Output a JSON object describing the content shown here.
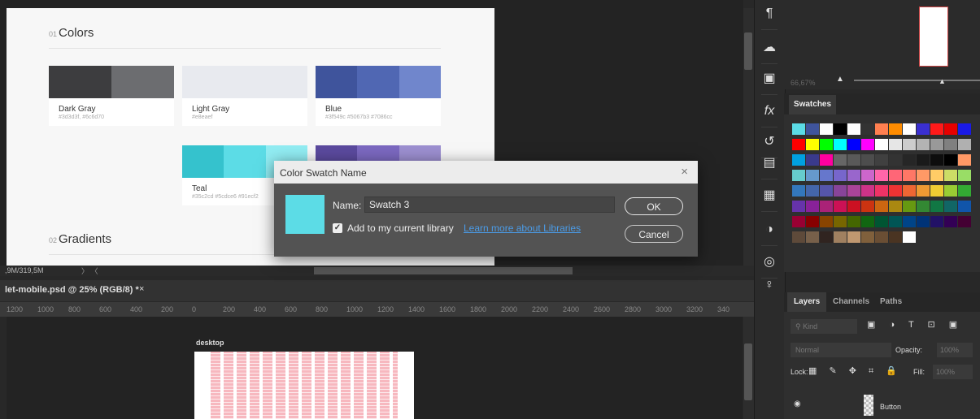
{
  "document_preview": {
    "colors_section": {
      "num": "01",
      "title": "Colors"
    },
    "gradients_section": {
      "num": "02",
      "title": "Gradients"
    },
    "swatch_cards": [
      {
        "label": "Dark Gray",
        "codes": "#3d3d3f, #6c6d70",
        "colors": [
          "#3d3d3f",
          "#6c6d70"
        ]
      },
      {
        "label": "Light Gray",
        "codes": "#e8eaef",
        "colors": [
          "#e8eaef"
        ]
      },
      {
        "label": "Blue",
        "codes": "#3f549c #5067b3 #7086cc",
        "colors": [
          "#3f549c",
          "#5067b3",
          "#7086cc"
        ]
      },
      {
        "label": "Teal",
        "codes": "#35c2cd #5cdce6 #91ecf2",
        "colors": [
          "#35c2cd",
          "#5cdce6",
          "#91ecf2"
        ]
      },
      {
        "label": "",
        "codes": "",
        "colors": [
          "#5b4a9e",
          "#7b68c0",
          "#9c8fd0"
        ]
      }
    ]
  },
  "status_bar": {
    "doc_size": ",9M/319,5M",
    "nav_arrows": "〉 〈"
  },
  "document_tab": {
    "title": "let-mobile.psd @ 25% (RGB/8) *",
    "close": "×"
  },
  "ruler": {
    "ticks": [
      "1200",
      "1000",
      "800",
      "600",
      "400",
      "200",
      "0",
      "200",
      "400",
      "600",
      "800",
      "1000",
      "1200",
      "1400",
      "1600",
      "1800",
      "2000",
      "2200",
      "2400",
      "2600",
      "2800",
      "3000",
      "3200",
      "340"
    ]
  },
  "artboard": {
    "label": "desktop"
  },
  "tools": [
    {
      "name": "paragraph-icon",
      "glyph": "¶"
    },
    {
      "name": "libraries-icon",
      "glyph": "☁"
    },
    {
      "name": "image-adjust-icon",
      "glyph": "▣"
    },
    {
      "name": "fx-styles-icon",
      "glyph": "fx"
    },
    {
      "name": "history-icon",
      "glyph": "↺"
    },
    {
      "name": "properties-icon",
      "glyph": "▤"
    },
    {
      "name": "grid-icon",
      "glyph": "▦"
    },
    {
      "name": "adjustment-icon",
      "glyph": "◑"
    },
    {
      "name": "creative-cloud-icon",
      "glyph": "◎"
    },
    {
      "name": "lightbulb-icon",
      "glyph": "♀"
    }
  ],
  "navigator": {
    "zoom": "66,67%"
  },
  "swatches_panel": {
    "tab_label": "Swatches",
    "rows": [
      [
        "#5bdbe6",
        "#3f549c",
        "#ffffff",
        "#000000",
        "#ffffff",
        "#333333",
        "#ff7f50",
        "#ff8c00",
        "#ffffff",
        "#3a2fd0",
        "#ff1a1a",
        "#e60000",
        "#1a1ae6"
      ],
      [
        "#ff0000",
        "#ffff00",
        "#00ff00",
        "#00ffff",
        "#0000ff",
        "#ff00ff",
        "#ffffff",
        "#e6e6e6",
        "#cccccc",
        "#b3b3b3",
        "#999999",
        "#808080",
        "#b0b0b0"
      ],
      [
        "#00a0e0",
        "#3a3a8c",
        "#ff00a0",
        "#666666",
        "#595959",
        "#4d4d4d",
        "#404040",
        "#333333",
        "#262626",
        "#1a1a1a",
        "#0d0d0d",
        "#000000",
        "#ff9966"
      ],
      [
        "#66cccc",
        "#6699cc",
        "#6677cc",
        "#7766cc",
        "#9966cc",
        "#cc66cc",
        "#ff66aa",
        "#ff6677",
        "#ff7766",
        "#ff9966",
        "#ffcc66",
        "#ccdd66",
        "#99dd66"
      ],
      [
        "#3377bb",
        "#4466aa",
        "#5555aa",
        "#884499",
        "#aa4499",
        "#cc3388",
        "#ee3366",
        "#ee3333",
        "#ee6633",
        "#ee9933",
        "#eecc33",
        "#99cc33",
        "#33aa33"
      ],
      [
        "#6633aa",
        "#882299",
        "#aa2277",
        "#cc1155",
        "#cc1122",
        "#cc3311",
        "#cc6611",
        "#aa8811",
        "#669911",
        "#338833",
        "#117744",
        "#116666",
        "#1155aa"
      ],
      [
        "#990033",
        "#880000",
        "#884400",
        "#776600",
        "#446600",
        "#116611",
        "#005533",
        "#005555",
        "#004488",
        "#003377",
        "#221166",
        "#330055",
        "#440033"
      ],
      [
        "#5e4a3a",
        "#77604a",
        "#302420",
        "#a08060",
        "#c09870",
        "#80603c",
        "#6a4e34",
        "#4a3422",
        "#ffffff"
      ]
    ]
  },
  "layers_panel": {
    "tabs": [
      "Layers",
      "Channels",
      "Paths"
    ],
    "kind_placeholder": "Kind",
    "filter_icons": "▣ ◑ T ⊡ ▣",
    "blend_mode": "Normal",
    "opacity_label": "Opacity:",
    "opacity_value": "100%",
    "lock_label": "Lock:",
    "lock_icons": "▦ ✎ ✥ ⌗ 🔒",
    "fill_label": "Fill:",
    "fill_value": "100%",
    "layer_name": "Button"
  },
  "dialog": {
    "title": "Color Swatch Name",
    "close": "×",
    "name_label": "Name:",
    "name_value": "Swatch 3",
    "preview_color": "#5cdce6",
    "add_to_library_label": "Add to my current library",
    "add_to_library_checked": true,
    "learn_more_link": "Learn more about Libraries",
    "ok_label": "OK",
    "cancel_label": "Cancel"
  }
}
